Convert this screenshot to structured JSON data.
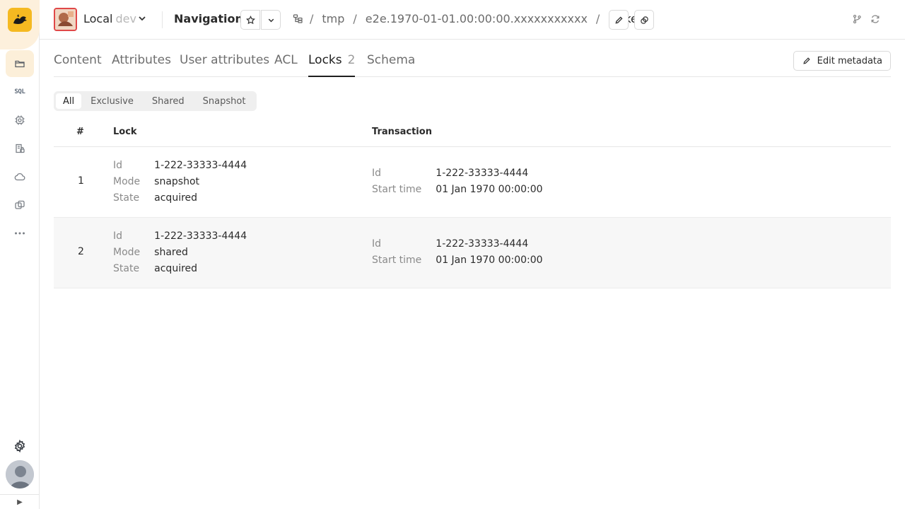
{
  "rail": {
    "sql_label": "SQL"
  },
  "header": {
    "cluster_name": "Local",
    "cluster_env": "dev",
    "page_title": "Navigation",
    "breadcrumbs": [
      "tmp",
      "e2e.1970-01-01.00:00:00.xxxxxxxxxxx"
    ],
    "current": "locked",
    "separator": "/"
  },
  "tabs": [
    {
      "label": "Content"
    },
    {
      "label": "Attributes"
    },
    {
      "label": "User attributes"
    },
    {
      "label": "ACL"
    },
    {
      "label": "Locks",
      "count": "2",
      "active": true
    },
    {
      "label": "Schema"
    }
  ],
  "edit_metadata_label": "Edit metadata",
  "filter": [
    "All",
    "Exclusive",
    "Shared",
    "Snapshot"
  ],
  "table": {
    "headers": {
      "num": "#",
      "lock": "Lock",
      "transaction": "Transaction"
    },
    "keys": {
      "id": "Id",
      "mode": "Mode",
      "state": "State",
      "start_time": "Start time"
    },
    "rows": [
      {
        "num": "1",
        "lock": {
          "id": "1-222-33333-4444",
          "mode": "snapshot",
          "state": "acquired"
        },
        "transaction": {
          "id": "1-222-33333-4444",
          "start_time": "01 Jan 1970 00:00:00"
        }
      },
      {
        "num": "2",
        "lock": {
          "id": "1-222-33333-4444",
          "mode": "shared",
          "state": "acquired"
        },
        "transaction": {
          "id": "1-222-33333-4444",
          "start_time": "01 Jan 1970 00:00:00"
        }
      }
    ]
  }
}
